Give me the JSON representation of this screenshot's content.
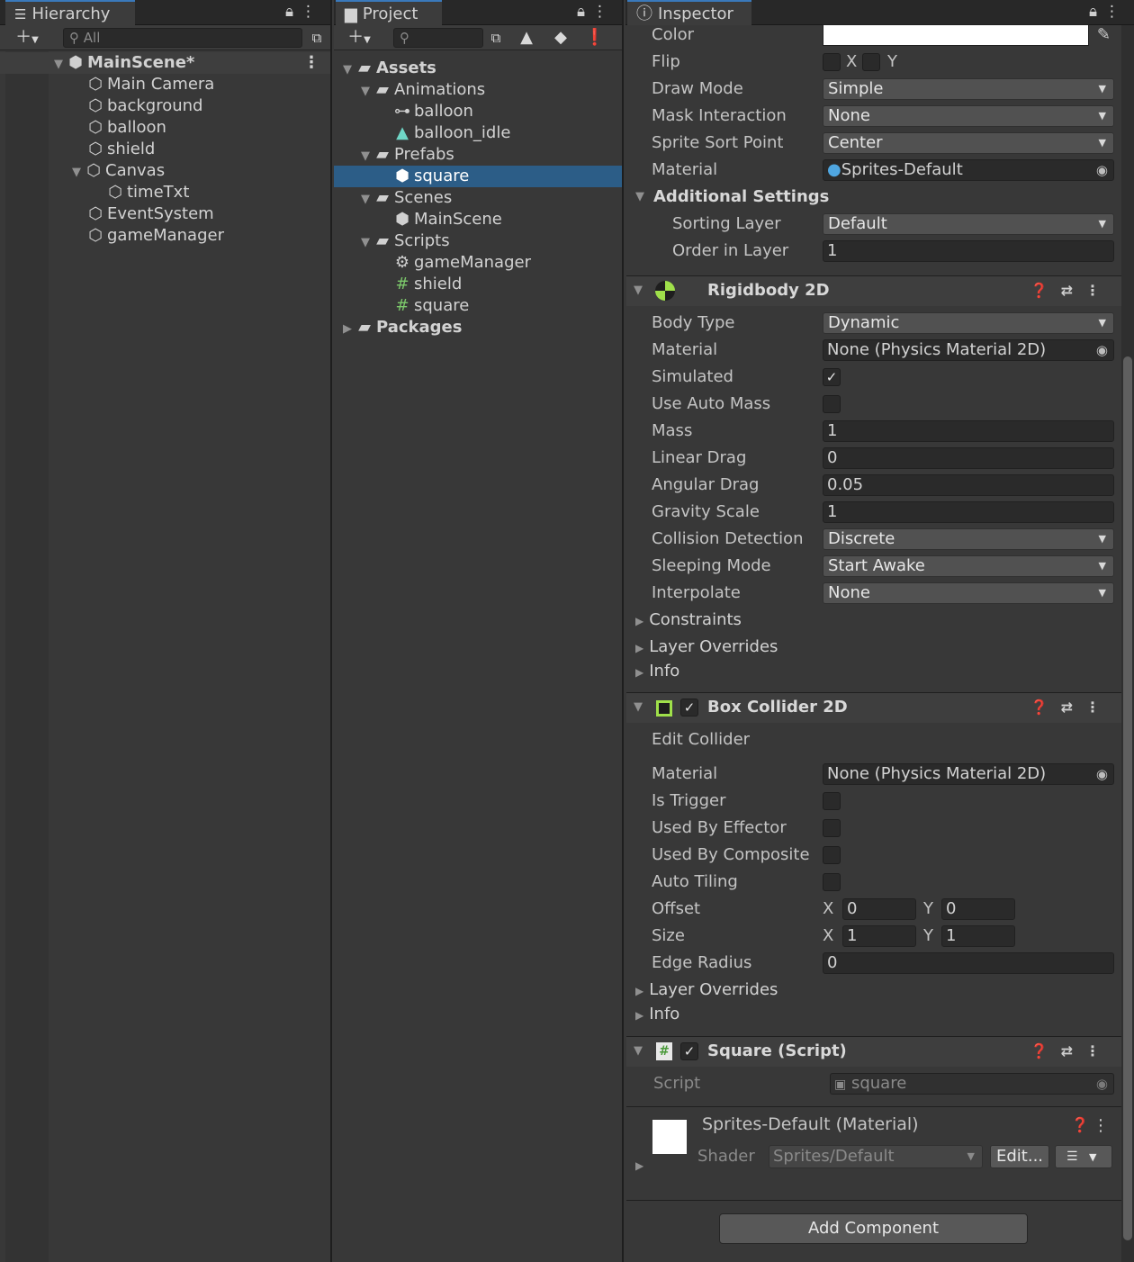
{
  "hierarchy": {
    "tab_label": "Hierarchy",
    "search_placeholder": "All",
    "scene": "MainScene*",
    "items": [
      {
        "label": "Main Camera"
      },
      {
        "label": "background"
      },
      {
        "label": "balloon"
      },
      {
        "label": "shield"
      },
      {
        "label": "Canvas"
      },
      {
        "label": "timeTxt"
      },
      {
        "label": "EventSystem"
      },
      {
        "label": "gameManager"
      }
    ]
  },
  "project": {
    "tab_label": "Project",
    "tree": {
      "assets": "Assets",
      "animations": "Animations",
      "anim_balloon": "balloon",
      "anim_balloon_idle": "balloon_idle",
      "prefabs": "Prefabs",
      "prefab_square": "square",
      "scenes": "Scenes",
      "scene_main": "MainScene",
      "scripts": "Scripts",
      "script_gamemanager": "gameManager",
      "script_shield": "shield",
      "script_square": "square",
      "packages": "Packages"
    }
  },
  "inspector": {
    "tab_label": "Inspector",
    "sprite_renderer": {
      "color_label": "Color",
      "flip_label": "Flip",
      "flip_x": "X",
      "flip_y": "Y",
      "draw_mode_label": "Draw Mode",
      "draw_mode": "Simple",
      "mask_label": "Mask Interaction",
      "mask": "None",
      "sort_point_label": "Sprite Sort Point",
      "sort_point": "Center",
      "material_label": "Material",
      "material": "Sprites-Default",
      "additional_label": "Additional Settings",
      "sorting_layer_label": "Sorting Layer",
      "sorting_layer": "Default",
      "order_label": "Order in Layer",
      "order": "1"
    },
    "rigidbody": {
      "title": "Rigidbody 2D",
      "body_type_label": "Body Type",
      "body_type": "Dynamic",
      "material_label": "Material",
      "material": "None (Physics Material 2D)",
      "simulated_label": "Simulated",
      "simulated": true,
      "auto_mass_label": "Use Auto Mass",
      "auto_mass": false,
      "mass_label": "Mass",
      "mass": "1",
      "linear_drag_label": "Linear Drag",
      "linear_drag": "0",
      "angular_drag_label": "Angular Drag",
      "angular_drag": "0.05",
      "gravity_label": "Gravity Scale",
      "gravity": "1",
      "collision_label": "Collision Detection",
      "collision": "Discrete",
      "sleeping_label": "Sleeping Mode",
      "sleeping": "Start Awake",
      "interpolate_label": "Interpolate",
      "interpolate": "None",
      "constraints": "Constraints",
      "layer_overrides": "Layer Overrides",
      "info": "Info"
    },
    "box_collider": {
      "title": "Box Collider 2D",
      "edit_collider": "Edit Collider",
      "material_label": "Material",
      "material": "None (Physics Material 2D)",
      "trigger_label": "Is Trigger",
      "effector_label": "Used By Effector",
      "composite_label": "Used By Composite",
      "tiling_label": "Auto Tiling",
      "offset_label": "Offset",
      "offset_x": "0",
      "offset_y": "0",
      "size_label": "Size",
      "size_x": "1",
      "size_y": "1",
      "axis_x": "X",
      "axis_y": "Y",
      "edge_label": "Edge Radius",
      "edge": "0",
      "layer_overrides": "Layer Overrides",
      "info": "Info"
    },
    "script": {
      "title": "Square (Script)",
      "script_label": "Script",
      "script_value": "square"
    },
    "material_asset": {
      "title": "Sprites-Default (Material)",
      "shader_label": "Shader",
      "shader": "Sprites/Default",
      "edit_button": "Edit..."
    },
    "add_component": "Add Component"
  },
  "colors": {
    "selection": "#2c5d87",
    "panel_bg": "#383838",
    "accent_tab": "#3a79bb"
  }
}
